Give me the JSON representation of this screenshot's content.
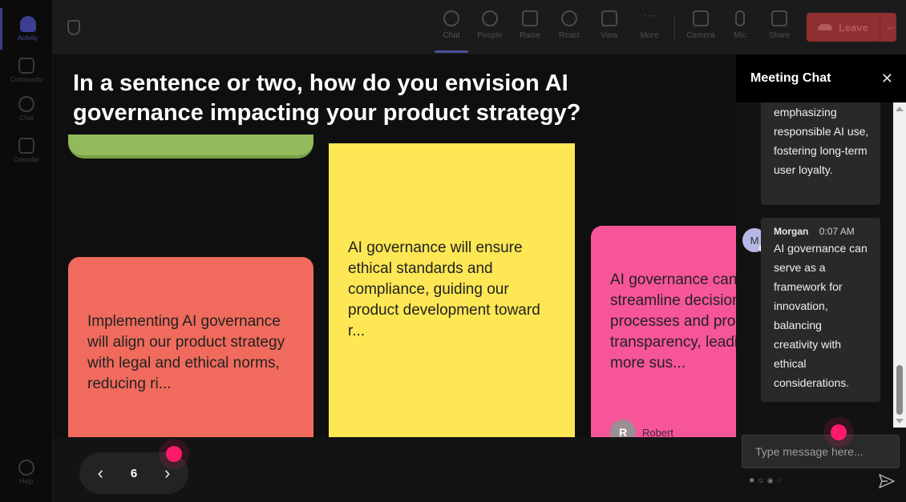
{
  "rail": {
    "items": [
      {
        "label": "Activity",
        "icon": "bell-icon",
        "active": true
      },
      {
        "label": "Community",
        "icon": "community-icon"
      },
      {
        "label": "Chat",
        "icon": "chat-icon"
      },
      {
        "label": "Calendar",
        "icon": "calendar-icon"
      }
    ],
    "help_label": "Help"
  },
  "toolbar": {
    "chat": "Chat",
    "people": "People",
    "raise": "Raise",
    "react": "React",
    "view": "View",
    "more": "More",
    "camera": "Camera",
    "mic": "Mic",
    "share": "Share",
    "leave": "Leave"
  },
  "stage": {
    "question": "In a sentence or two, how do you envision AI governance impacting your product strategy?",
    "notes": {
      "red": "Implementing AI governance will align our product strategy with legal and ethical norms, reducing ri...",
      "yellow": "AI governance will ensure ethical standards and compliance, guiding our product development toward r...",
      "pink": "AI governance can streamline decision processes and promote transparency, leading to more sus...",
      "pink_author_initial": "R",
      "pink_author_name": "Robert"
    },
    "pager": {
      "page": "6"
    }
  },
  "chat": {
    "title": "Meeting Chat",
    "messages": [
      {
        "author": "",
        "time": "",
        "text": "emphasizing responsible AI use, fostering long-term user loyalty."
      },
      {
        "author": "Morgan",
        "initial": "M",
        "time": "0:07 AM",
        "text": "AI governance can serve as a framework for innovation, balancing creativity with ethical considerations."
      }
    ],
    "input_placeholder": "Type message here..."
  },
  "colors": {
    "note_red": "#f06b5d",
    "note_yellow": "#fde754",
    "note_pink": "#f7559a",
    "note_green": "#92ba5a",
    "cursor_dot": "#ff1a6b",
    "leave_button": "#8f2f31"
  }
}
